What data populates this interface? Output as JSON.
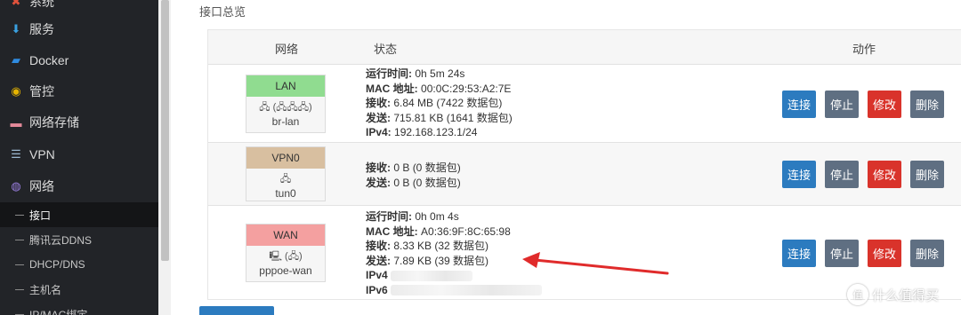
{
  "sidebar": {
    "items": [
      {
        "label": "系统",
        "icon": "x-icon",
        "color": "#e0523c"
      },
      {
        "label": "服务",
        "icon": "download-icon",
        "color": "#3aa0e0"
      },
      {
        "label": "Docker",
        "icon": "docker-icon",
        "color": "#2f8be0"
      },
      {
        "label": "管控",
        "icon": "shield-icon",
        "color": "#e6b400"
      },
      {
        "label": "网络存储",
        "icon": "storage-icon",
        "color": "#e48a9a"
      },
      {
        "label": "VPN",
        "icon": "list-icon",
        "color": "#9bb7d0"
      },
      {
        "label": "网络",
        "icon": "globe-icon",
        "color": "#9b7fe0"
      }
    ],
    "subitems": [
      {
        "label": "接口",
        "active": true
      },
      {
        "label": "腾讯云DDNS"
      },
      {
        "label": "DHCP/DNS"
      },
      {
        "label": "主机名"
      },
      {
        "label": "IP/MAC绑定"
      }
    ]
  },
  "main": {
    "section_title": "接口总览",
    "columns": {
      "network": "网络",
      "status": "状态",
      "action": "动作"
    },
    "buttons": {
      "connect": "连接",
      "stop": "停止",
      "edit": "修改",
      "delete": "删除"
    },
    "interfaces": [
      {
        "name": "LAN",
        "color": "#90dc90",
        "icons": "🖧 (🖧🖧🖧)",
        "device": "br-lan",
        "uptime_label": "运行时间:",
        "uptime": "0h 5m 24s",
        "mac_label": "MAC 地址:",
        "mac": "00:0C:29:53:A2:7E",
        "rx_label": "接收:",
        "rx": "6.84 MB (7422 数据包)",
        "tx_label": "发送:",
        "tx": "715.81 KB (1641 数据包)",
        "ipv4_label": "IPv4:",
        "ipv4": "192.168.123.1/24"
      },
      {
        "name": "VPN0",
        "color": "#d8bfa0",
        "icons": "🖧",
        "device": "tun0",
        "rx_label": "接收:",
        "rx": "0 B (0 数据包)",
        "tx_label": "发送:",
        "tx": "0 B (0 数据包)"
      },
      {
        "name": "WAN",
        "color": "#f4a0a0",
        "icons": "🖳 (🖧)",
        "device": "pppoe-wan",
        "uptime_label": "运行时间:",
        "uptime": "0h 0m 4s",
        "mac_label": "MAC 地址:",
        "mac": "A0:36:9F:8C:65:98",
        "rx_label": "接收:",
        "rx": "8.33 KB (32 数据包)",
        "tx_label": "发送:",
        "tx": "7.89 KB (39 数据包)",
        "ipv4_label": "IPv4",
        "ipv6_label": "IPv6"
      }
    ]
  },
  "watermark": {
    "text": "什么值得买",
    "logo": "值"
  }
}
